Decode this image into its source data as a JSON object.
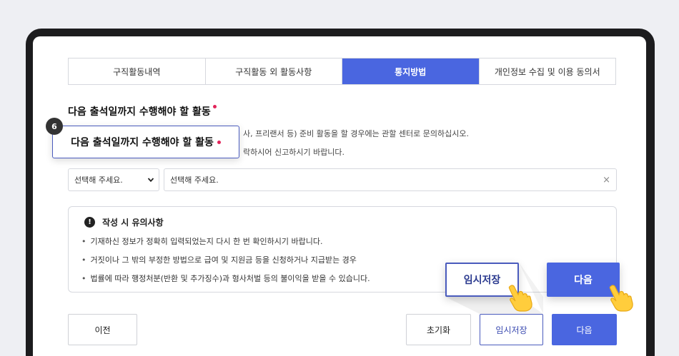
{
  "tabs": [
    {
      "label": "구직활동내역"
    },
    {
      "label": "구직활동 외 활동사항"
    },
    {
      "label": "통지방법"
    },
    {
      "label": "개인정보 수집 및 이용 동의서"
    }
  ],
  "section": {
    "title": "다음 출석일까지 수행해야 할 활동",
    "desc_line1": "사, 프리랜서 등) 준비 활동을 할 경우에는 관할 센터로 문의하십시오.",
    "desc_line2": "락하시어 신고하시기 바랍니다."
  },
  "callout": {
    "step": "6",
    "label": "다음 출석일까지 수행해야 할 활동"
  },
  "form": {
    "select_value": "선택해 주세요.",
    "input_value": "선택해 주세요.",
    "clear_symbol": "×"
  },
  "notice": {
    "title": "작성 시 유의사항",
    "icon_symbol": "!",
    "items": [
      "기재하신 정보가 정확히 입력되었는지 다시 한 번 확인하시기 바랍니다.",
      "거짓이나 그 밖의 부정한 방법으로 급여 및 지원금 등을 신청하거나 지급받는 경우",
      "법률에 따라 행정처분(반환 및 추가징수)과 형사처벌 등의 불이익을 받을 수 있습니다."
    ]
  },
  "buttons": {
    "prev": "이전",
    "reset": "초기화",
    "temp_save": "임시저장",
    "next": "다음"
  },
  "popups": {
    "temp_save": "임시저장",
    "next": "다음"
  },
  "colors": {
    "accent": "#4a66e0",
    "required_dot": "#e2245a",
    "frame": "#1c1c1e"
  },
  "icons": {
    "dropdown": "chevron-down-icon",
    "hand": "pointing-hand-icon",
    "notice": "exclamation-icon"
  }
}
